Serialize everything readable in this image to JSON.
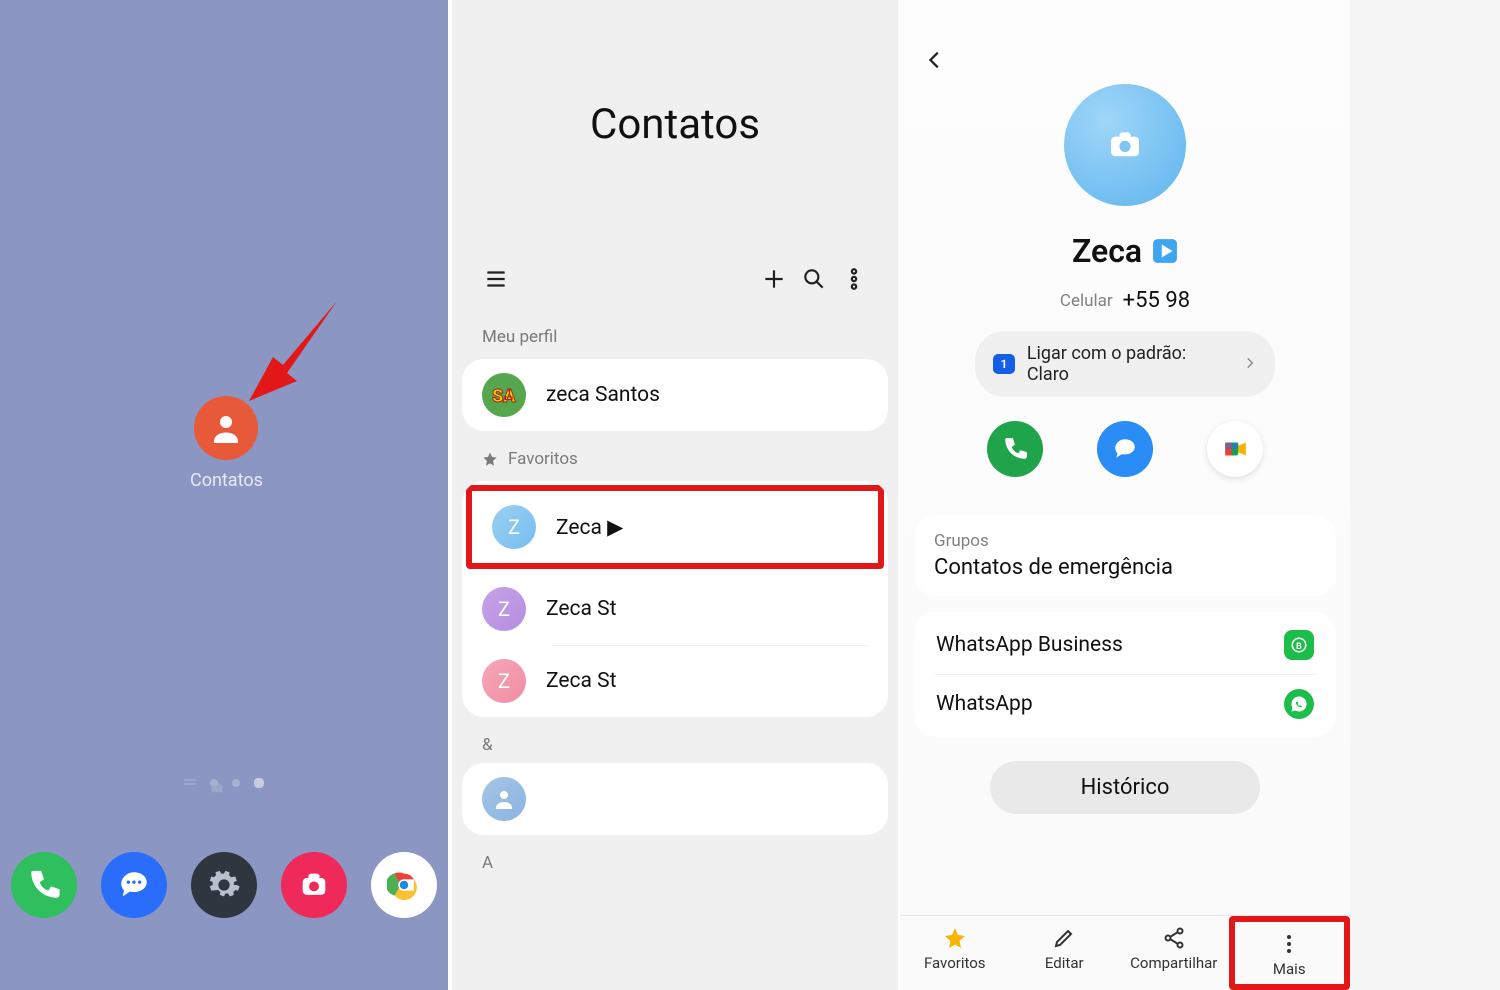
{
  "panel1": {
    "app_label": "Contatos",
    "dock": [
      "phone",
      "messages",
      "settings",
      "camera",
      "chrome"
    ]
  },
  "panel2": {
    "title": "Contatos",
    "sections": {
      "profile_label": "Meu perfil",
      "profile_name": "zeca Santos",
      "fav_label": "Favoritos",
      "favorites": [
        {
          "name": "Zeca ▶",
          "initial": "Z",
          "color": "z-blue"
        },
        {
          "name": "Zeca St",
          "initial": "Z",
          "color": "z-purple"
        },
        {
          "name": "Zeca St",
          "initial": "Z",
          "color": "z-pink"
        }
      ],
      "index_sym": "&",
      "index_a": "A"
    }
  },
  "panel3": {
    "name": "Zeca",
    "phone_label": "Celular",
    "phone_number": "+55 98",
    "sim_badge": "1",
    "call_default": "Ligar com o padrão: Claro",
    "groups_label": "Grupos",
    "groups_value": "Contatos de emergência",
    "links": {
      "wab": "WhatsApp Business",
      "wa": "WhatsApp"
    },
    "history": "Histórico",
    "bottom": {
      "fav": "Favoritos",
      "edit": "Editar",
      "share": "Compartilhar",
      "more": "Mais"
    }
  }
}
